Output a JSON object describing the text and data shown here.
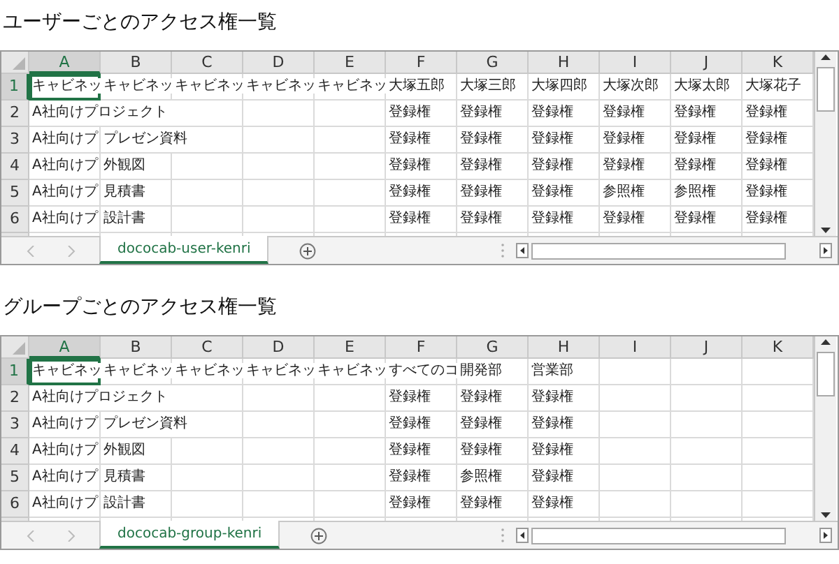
{
  "sections": [
    {
      "title": "ユーザーごとのアクセス権一覧",
      "sheet": {
        "columns": [
          "A",
          "B",
          "C",
          "D",
          "E",
          "F",
          "G",
          "H",
          "I",
          "J",
          "K"
        ],
        "rows": [
          {
            "number": "1",
            "cells": [
              {
                "text": "キャビネッ",
                "selected": true
              },
              {
                "text": "キャビネッ",
                "selected": false
              },
              {
                "text": "キャビネッ",
                "selected": false
              },
              {
                "text": "キャビネッ",
                "selected": false
              },
              {
                "text": "キャビネッ",
                "selected": false
              },
              {
                "text": "大塚五郎",
                "selected": false
              },
              {
                "text": "大塚三郎",
                "selected": false
              },
              {
                "text": "大塚四郎",
                "selected": false
              },
              {
                "text": "大塚次郎",
                "selected": false
              },
              {
                "text": "大塚太郎",
                "selected": false
              },
              {
                "text": "大塚花子",
                "selected": false
              }
            ]
          },
          {
            "number": "2",
            "cells": [
              {
                "text": "A社向けプロジェクト",
                "selected": false
              },
              {
                "selected": false
              },
              {
                "selected": false
              },
              {
                "selected": false
              },
              {
                "selected": false
              },
              {
                "text": "登録権",
                "selected": false
              },
              {
                "text": "登録権",
                "selected": false
              },
              {
                "text": "登録権",
                "selected": false
              },
              {
                "text": "登録権",
                "selected": false
              },
              {
                "text": "登録権",
                "selected": false
              },
              {
                "text": "登録権",
                "selected": false
              }
            ]
          },
          {
            "number": "3",
            "cells": [
              {
                "text": "A社向けプ",
                "selected": false
              },
              {
                "text": "プレゼン資料",
                "selected": false
              },
              {
                "selected": false
              },
              {
                "selected": false
              },
              {
                "selected": false
              },
              {
                "text": "登録権",
                "selected": false
              },
              {
                "text": "登録権",
                "selected": false
              },
              {
                "text": "登録権",
                "selected": false
              },
              {
                "text": "登録権",
                "selected": false
              },
              {
                "text": "登録権",
                "selected": false
              },
              {
                "text": "登録権",
                "selected": false
              }
            ]
          },
          {
            "number": "4",
            "cells": [
              {
                "text": "A社向けプ",
                "selected": false
              },
              {
                "text": "外観図",
                "selected": false
              },
              {
                "selected": false
              },
              {
                "selected": false
              },
              {
                "selected": false
              },
              {
                "text": "登録権",
                "selected": false
              },
              {
                "text": "登録権",
                "selected": false
              },
              {
                "text": "登録権",
                "selected": false
              },
              {
                "text": "登録権",
                "selected": false
              },
              {
                "text": "登録権",
                "selected": false
              },
              {
                "text": "登録権",
                "selected": false
              }
            ]
          },
          {
            "number": "5",
            "cells": [
              {
                "text": "A社向けプ",
                "selected": false
              },
              {
                "text": "見積書",
                "selected": false
              },
              {
                "selected": false
              },
              {
                "selected": false
              },
              {
                "selected": false
              },
              {
                "text": "登録権",
                "selected": false
              },
              {
                "text": "登録権",
                "selected": false
              },
              {
                "text": "登録権",
                "selected": false
              },
              {
                "text": "参照権",
                "selected": false
              },
              {
                "text": "参照権",
                "selected": false
              },
              {
                "text": "登録権",
                "selected": false
              }
            ]
          },
          {
            "number": "6",
            "cells": [
              {
                "text": "A社向けプ",
                "selected": false
              },
              {
                "text": "設計書",
                "selected": false
              },
              {
                "selected": false
              },
              {
                "selected": false
              },
              {
                "selected": false
              },
              {
                "text": "登録権",
                "selected": false
              },
              {
                "text": "登録権",
                "selected": false
              },
              {
                "text": "登録権",
                "selected": false
              },
              {
                "text": "登録権",
                "selected": false
              },
              {
                "text": "登録権",
                "selected": false
              },
              {
                "text": "登録権",
                "selected": false
              }
            ]
          }
        ],
        "tabs": [
          {
            "label": "dococab-user-kenri",
            "selected": true
          }
        ]
      }
    },
    {
      "title": "グループごとのアクセス権一覧",
      "sheet": {
        "columns": [
          "A",
          "B",
          "C",
          "D",
          "E",
          "F",
          "G",
          "H",
          "I",
          "J",
          "K"
        ],
        "rows": [
          {
            "number": "1",
            "cells": [
              {
                "text": "キャビネッ",
                "selected": true
              },
              {
                "text": "キャビネッ",
                "selected": false
              },
              {
                "text": "キャビネッ",
                "selected": false
              },
              {
                "text": "キャビネッ",
                "selected": false
              },
              {
                "text": "キャビネッ",
                "selected": false
              },
              {
                "text": "すべてのコ",
                "selected": false
              },
              {
                "text": "開発部",
                "selected": false
              },
              {
                "text": "営業部",
                "selected": false
              },
              {
                "selected": false
              },
              {
                "selected": false
              },
              {
                "selected": false
              }
            ]
          },
          {
            "number": "2",
            "cells": [
              {
                "text": "A社向けプロジェクト",
                "selected": false
              },
              {
                "selected": false
              },
              {
                "selected": false
              },
              {
                "selected": false
              },
              {
                "selected": false
              },
              {
                "text": "登録権",
                "selected": false
              },
              {
                "text": "登録権",
                "selected": false
              },
              {
                "text": "登録権",
                "selected": false
              },
              {
                "selected": false
              },
              {
                "selected": false
              },
              {
                "selected": false
              }
            ]
          },
          {
            "number": "3",
            "cells": [
              {
                "text": "A社向けプ",
                "selected": false
              },
              {
                "text": "プレゼン資料",
                "selected": false
              },
              {
                "selected": false
              },
              {
                "selected": false
              },
              {
                "selected": false
              },
              {
                "text": "登録権",
                "selected": false
              },
              {
                "text": "登録権",
                "selected": false
              },
              {
                "text": "登録権",
                "selected": false
              },
              {
                "selected": false
              },
              {
                "selected": false
              },
              {
                "selected": false
              }
            ]
          },
          {
            "number": "4",
            "cells": [
              {
                "text": "A社向けプ",
                "selected": false
              },
              {
                "text": "外観図",
                "selected": false
              },
              {
                "selected": false
              },
              {
                "selected": false
              },
              {
                "selected": false
              },
              {
                "text": "登録権",
                "selected": false
              },
              {
                "text": "登録権",
                "selected": false
              },
              {
                "text": "登録権",
                "selected": false
              },
              {
                "selected": false
              },
              {
                "selected": false
              },
              {
                "selected": false
              }
            ]
          },
          {
            "number": "5",
            "cells": [
              {
                "text": "A社向けプ",
                "selected": false
              },
              {
                "text": "見積書",
                "selected": false
              },
              {
                "selected": false
              },
              {
                "selected": false
              },
              {
                "selected": false
              },
              {
                "text": "登録権",
                "selected": false
              },
              {
                "text": "参照権",
                "selected": false
              },
              {
                "text": "登録権",
                "selected": false
              },
              {
                "selected": false
              },
              {
                "selected": false
              },
              {
                "selected": false
              }
            ]
          },
          {
            "number": "6",
            "cells": [
              {
                "text": "A社向けプ",
                "selected": false
              },
              {
                "text": "設計書",
                "selected": false
              },
              {
                "selected": false
              },
              {
                "selected": false
              },
              {
                "selected": false
              },
              {
                "text": "登録権",
                "selected": false
              },
              {
                "text": "登録権",
                "selected": false
              },
              {
                "text": "登録権",
                "selected": false
              },
              {
                "selected": false
              },
              {
                "selected": false
              },
              {
                "selected": false
              }
            ]
          }
        ],
        "tabs": [
          {
            "label": "dococab-group-kenri",
            "selected": true
          }
        ]
      }
    }
  ]
}
